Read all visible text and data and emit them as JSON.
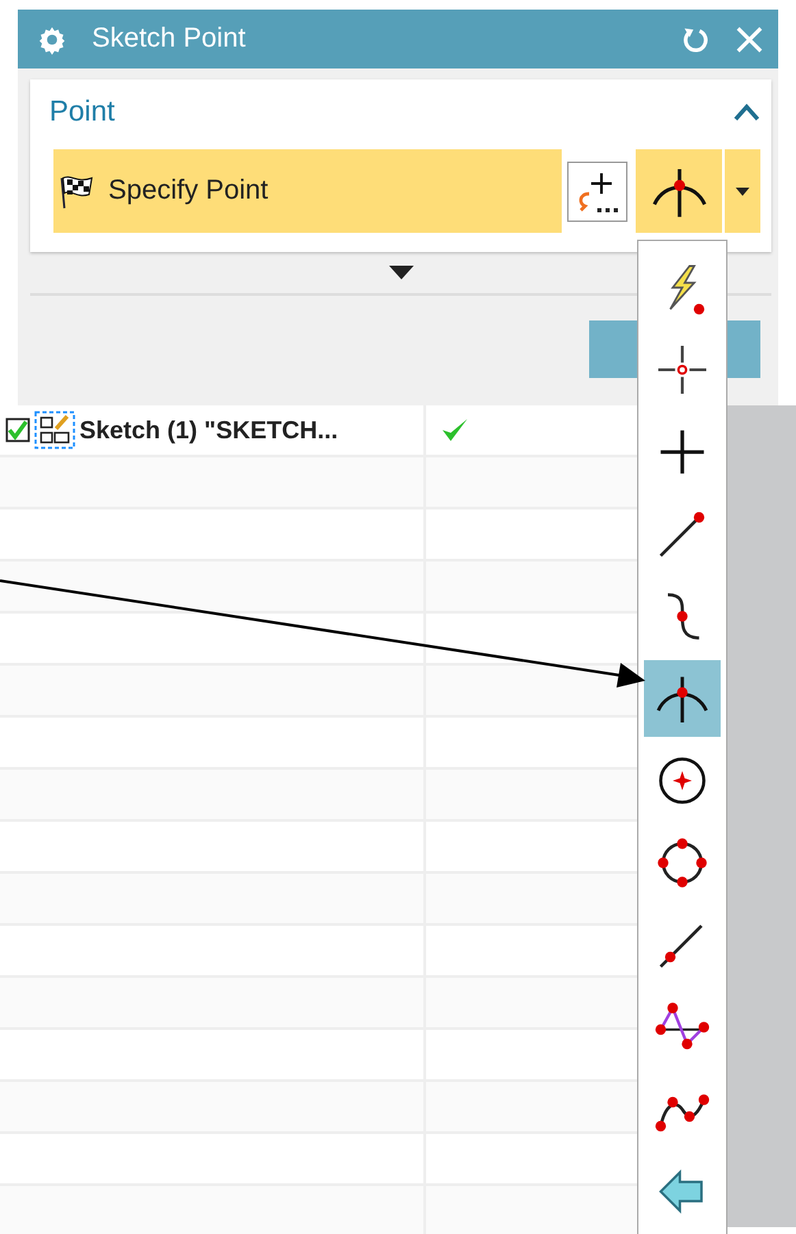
{
  "window": {
    "title": "Sketch Point"
  },
  "group": {
    "title": "Point",
    "expanded": true,
    "selection": {
      "label": "Specify Point"
    }
  },
  "point_types": [
    {
      "kind": "inferred",
      "selected": false
    },
    {
      "kind": "cursor",
      "selected": false
    },
    {
      "kind": "existing",
      "selected": false
    },
    {
      "kind": "endpoint",
      "selected": false
    },
    {
      "kind": "control",
      "selected": false
    },
    {
      "kind": "intersection",
      "selected": true
    },
    {
      "kind": "center",
      "selected": false
    },
    {
      "kind": "quadrant",
      "selected": false
    },
    {
      "kind": "on_curve",
      "selected": false
    },
    {
      "kind": "between",
      "selected": false
    },
    {
      "kind": "spline",
      "selected": false
    },
    {
      "kind": "back",
      "selected": false
    }
  ],
  "table": {
    "rows": [
      {
        "name": "Sketch (1) \"SKETCH...",
        "checked": true,
        "valid": true
      }
    ]
  }
}
